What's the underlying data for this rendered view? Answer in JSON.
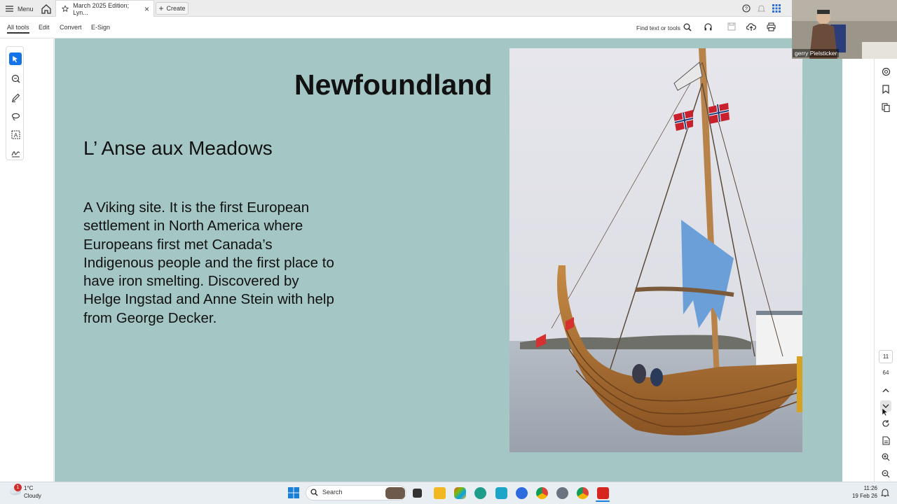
{
  "tabbar": {
    "menu_label": "Menu",
    "doc_tab_title": "March 2025 Edition; Lyn...",
    "create_label": "Create"
  },
  "toolbar": {
    "tabs": [
      "All tools",
      "Edit",
      "Convert",
      "E-Sign"
    ],
    "find_label": "Find text or tools"
  },
  "slide": {
    "title": "Newfoundland",
    "subtitle": "L’ Anse aux Meadows",
    "body": "A Viking site. It is the first European settlement in North America where Europeans first met Canada’s Indigenous people and the first place to have iron smelting. Discovered by Helge Ingstad and Anne Stein with help from George Decker."
  },
  "page_nav": {
    "current_page": "11",
    "total_pages": "64"
  },
  "webcam": {
    "participant_name": "gerry Pielsticker"
  },
  "taskbar": {
    "weather_temp": "1°C",
    "weather_desc": "Cloudy",
    "search_label": "Search",
    "time": "11:26",
    "date": "19 Feb 26",
    "notification_count": "1"
  },
  "colors": {
    "slide_bg": "#a4c7c5",
    "accent": "#1473e6",
    "acrobat_red": "#d7261e"
  },
  "icons": [
    "menu-icon",
    "home-icon",
    "star-icon",
    "close-icon",
    "plus-icon",
    "help-icon",
    "bell-icon",
    "apps-icon",
    "search-icon",
    "headphones-icon",
    "save-icon",
    "cloud-upload-icon",
    "print-icon",
    "cursor-icon",
    "zoom-comment-icon",
    "pen-icon",
    "lasso-icon",
    "text-select-icon",
    "sign-icon",
    "ai-assistant-icon",
    "bookmark-icon",
    "pages-icon",
    "chevron-up-icon",
    "chevron-down-icon",
    "rotate-icon",
    "file-icon",
    "zoom-in-icon",
    "zoom-out-icon",
    "windows-icon"
  ]
}
